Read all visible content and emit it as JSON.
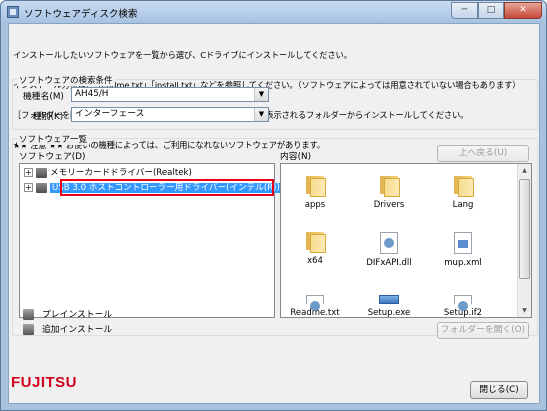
{
  "window": {
    "title": "ソフトウェアディスク検索",
    "minimize_label": "─",
    "maximize_label": "□",
    "close_label": "✕"
  },
  "instructions": [
    "インストールしたいソフトウェアを一覧から選び、Cドライブにインストールしてください。",
    "インストール方法は、「readme.txt」「install.txt」などを参照してください。（ソフトウェアによっては用意されていない場合もあります）",
    "［フォルダーを開く］ボタンが有効の場合は、ボタンをクリックして表示されるフォルダーからインストールしてください。",
    "★★ 注意 ★★ お使いの機種によっては、ご利用になれないソフトウェアがあります。"
  ],
  "search": {
    "group_label": "ソフトウェアの検索条件",
    "model_label": "機種名(M)",
    "model_value": "AH45/H",
    "type_label": "種別(K)",
    "type_value": "インターフェース",
    "dropdown_arrow": "▼"
  },
  "list": {
    "group_label": "ソフトウェア一覧",
    "software_label": "ソフトウェア(D)",
    "contents_label": "内容(N)",
    "up_button": "上へ戻る(U)",
    "open_folder_button": "フォルダーを開く(O)",
    "tree": [
      {
        "label": "メモリーカードドライバー(Realtek)",
        "expander": "+"
      },
      {
        "label": "USB 3.0 ホストコントローラー用ドライバー(インテル(R))",
        "expander": "+",
        "selected": true
      }
    ],
    "files": [
      {
        "name": "apps",
        "icon": "folder-icon"
      },
      {
        "name": "Drivers",
        "icon": "folder-icon"
      },
      {
        "name": "Lang",
        "icon": "folder-icon"
      },
      {
        "name": "x64",
        "icon": "folder-icon"
      },
      {
        "name": "DIFxAPI.dll",
        "icon": "dll-file-icon"
      },
      {
        "name": "mup.xml",
        "icon": "xml-file-icon"
      },
      {
        "name": "Readme.txt",
        "icon": "text-file-icon"
      },
      {
        "name": "Setup.exe",
        "icon": "setup-exe-icon"
      },
      {
        "name": "Setup.if2",
        "icon": "file-icon"
      }
    ],
    "scroll_up": "▲",
    "scroll_down": "▼"
  },
  "legend": {
    "preinstall": "プレインストール",
    "additional": "追加インストール"
  },
  "footer": {
    "brand": "FUJITSU",
    "close_button": "閉じる(C)"
  },
  "colors": {
    "selection_outline": "#e8001a",
    "selection_fill": "#3399ff",
    "brand_red": "#d0001c"
  }
}
